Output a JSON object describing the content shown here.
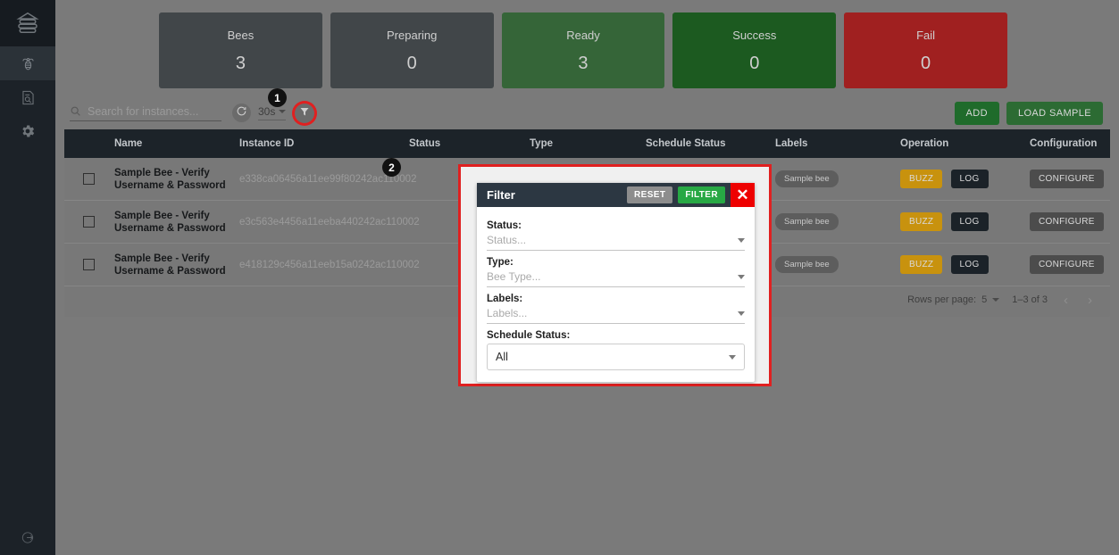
{
  "sidebar": {
    "items": [
      {
        "name": "beehive-logo",
        "icon": "beehive-icon",
        "active": false
      },
      {
        "name": "bees",
        "icon": "bee-icon",
        "active": true
      },
      {
        "name": "logs",
        "icon": "log-search-icon",
        "active": false
      },
      {
        "name": "settings",
        "icon": "gear-icon",
        "active": false
      }
    ],
    "logout_icon": "logout-icon"
  },
  "cards": [
    {
      "label": "Bees",
      "value": "3",
      "color": "#414649"
    },
    {
      "label": "Preparing",
      "value": "0",
      "color": "#414649"
    },
    {
      "label": "Ready",
      "value": "3",
      "color": "#356538"
    },
    {
      "label": "Success",
      "value": "0",
      "color": "#1c5a20"
    },
    {
      "label": "Fail",
      "value": "0",
      "color": "#a02020"
    }
  ],
  "toolbar": {
    "search_placeholder": "Search for instances...",
    "search_value": "",
    "search_icon": "search-icon",
    "refresh_icon": "refresh-icon",
    "interval_value": "30s",
    "filter_icon": "funnel-icon",
    "add_label": "ADD",
    "load_sample_label": "LOAD SAMPLE"
  },
  "table": {
    "columns": [
      "",
      "Name",
      "Instance ID",
      "Status",
      "Type",
      "Schedule Status",
      "Labels",
      "Operation",
      "Configuration"
    ],
    "rows": [
      {
        "name": "Sample Bee - Verify Username & Password",
        "instance_id": "e338ca06456a11ee99f80242ac110002",
        "status": "",
        "type": "",
        "schedule_status": "",
        "label": "Sample bee",
        "buzz_label": "BUZZ",
        "log_label": "LOG",
        "configure_label": "CONFIGURE"
      },
      {
        "name": "Sample Bee - Verify Username & Password",
        "instance_id": "e3c563e4456a11eeba440242ac110002",
        "status": "",
        "type": "",
        "schedule_status": "",
        "label": "Sample bee",
        "buzz_label": "BUZZ",
        "log_label": "LOG",
        "configure_label": "CONFIGURE"
      },
      {
        "name": "Sample Bee - Verify Username & Password",
        "instance_id": "e418129c456a11eeb15a0242ac110002",
        "status": "",
        "type": "",
        "schedule_status": "",
        "label": "Sample bee",
        "buzz_label": "BUZZ",
        "log_label": "LOG",
        "configure_label": "CONFIGURE"
      }
    ],
    "footer": {
      "rows_per_page_label": "Rows per page:",
      "rows_per_page_value": "5",
      "range_label": "1–3 of 3",
      "prev_icon": "chevron-left-icon",
      "next_icon": "chevron-right-icon"
    }
  },
  "filter_dialog": {
    "title": "Filter",
    "reset_label": "RESET",
    "filter_label": "FILTER",
    "close_label": "✕",
    "fields": [
      {
        "label": "Status:",
        "placeholder": "Status...",
        "value": "",
        "variant": "underline"
      },
      {
        "label": "Type:",
        "placeholder": "Bee Type...",
        "value": "",
        "variant": "underline"
      },
      {
        "label": "Labels:",
        "placeholder": "Labels...",
        "value": "",
        "variant": "underline"
      },
      {
        "label": "Schedule Status:",
        "placeholder": "",
        "value": "All",
        "variant": "boxed"
      }
    ]
  },
  "annotations": [
    {
      "number": "1",
      "target": "filter-toolbar-button"
    },
    {
      "number": "2",
      "target": "filter-dialog"
    }
  ],
  "colors": {
    "accent_red": "#e02020",
    "green": "#27a844",
    "amber": "#c8920e",
    "dark": "#1c2329"
  }
}
